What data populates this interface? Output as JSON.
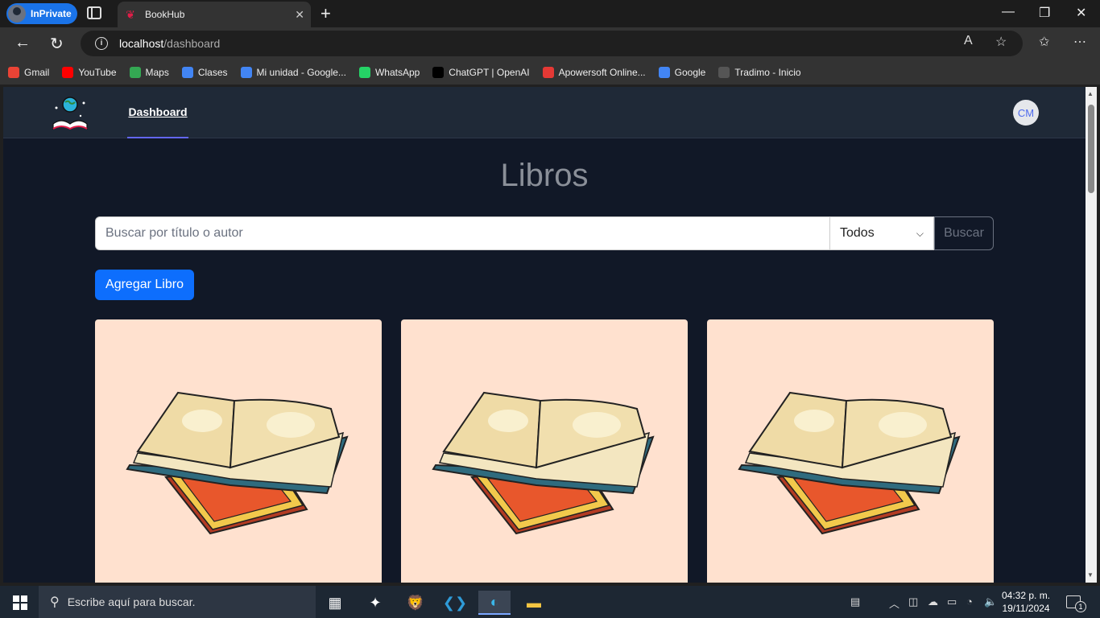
{
  "browser": {
    "inprivate_label": "InPrivate",
    "tab_title": "BookHub",
    "url_host": "localhost",
    "url_path": "/dashboard",
    "bookmarks": [
      {
        "label": "Gmail",
        "color": "#ea4335",
        "icon": "gmail-icon"
      },
      {
        "label": "YouTube",
        "color": "#ff0000",
        "icon": "youtube-icon"
      },
      {
        "label": "Maps",
        "color": "#34a853",
        "icon": "maps-icon"
      },
      {
        "label": "Clases",
        "color": "#4285f4",
        "icon": "google-icon"
      },
      {
        "label": "Mi unidad - Google...",
        "color": "#4285f4",
        "icon": "google-icon"
      },
      {
        "label": "WhatsApp",
        "color": "#25d366",
        "icon": "whatsapp-icon"
      },
      {
        "label": "ChatGPT | OpenAI",
        "color": "#000000",
        "icon": "openai-icon"
      },
      {
        "label": "Apowersoft Online...",
        "color": "#e53935",
        "icon": "apowersoft-icon"
      },
      {
        "label": "Google",
        "color": "#4285f4",
        "icon": "google-icon"
      },
      {
        "label": "Tradimo - Inicio",
        "color": "#555555",
        "icon": "grid-icon"
      }
    ]
  },
  "app": {
    "nav_link": "Dashboard",
    "avatar_initials": "CM",
    "page_title": "Libros",
    "search_placeholder": "Buscar por título o autor",
    "filter_selected": "Todos",
    "search_button": "Buscar",
    "add_button": "Agregar Libro",
    "colors": {
      "page_bg": "#111827",
      "nav_bg": "#1f2937",
      "primary": "#0d6efd",
      "card_bg": "#ffe1cf",
      "nav_underline": "#6366f1"
    }
  },
  "taskbar": {
    "search_placeholder": "Escribe aquí para buscar.",
    "time": "04:32 p. m.",
    "date": "19/11/2024",
    "notifications": "1"
  }
}
